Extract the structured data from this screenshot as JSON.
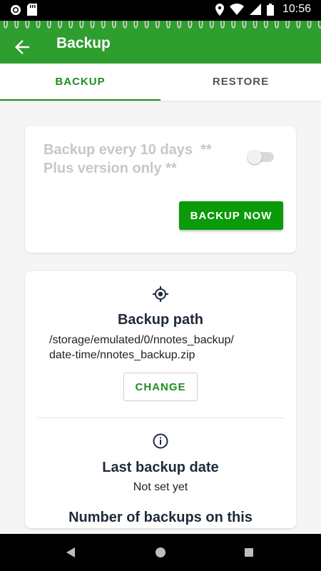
{
  "status_bar": {
    "time": "10:56",
    "icons": [
      "sync-icon",
      "sd-card-icon",
      "location-icon",
      "wifi-icon",
      "signal-icon",
      "battery-icon"
    ]
  },
  "app_bar": {
    "title": "Backup",
    "back_icon": "arrow-back-icon",
    "color": "#2e9e2e"
  },
  "tabs": [
    {
      "label": "BACKUP",
      "selected": true
    },
    {
      "label": "RESTORE",
      "selected": false
    }
  ],
  "auto_backup": {
    "label": "Backup every 10 days  **\nPlus version only **",
    "enabled": false,
    "button_label": "BACKUP NOW"
  },
  "backup_path": {
    "icon": "target-icon",
    "title": "Backup path",
    "value": "/storage/emulated/0/nnotes_backup/date-time/nnotes_backup.zip",
    "change_label": "CHANGE"
  },
  "last_backup": {
    "icon": "info-icon",
    "title": "Last backup date",
    "value": "Not set yet"
  },
  "number_of_backups": {
    "title": "Number of backups on this"
  },
  "colors": {
    "accent": "#1e8f1e",
    "button": "#0a9a0a",
    "disabled_text": "#c7c7c7"
  },
  "nav_bar": {
    "icons": [
      "nav-back-icon",
      "nav-home-icon",
      "nav-recents-icon"
    ]
  }
}
